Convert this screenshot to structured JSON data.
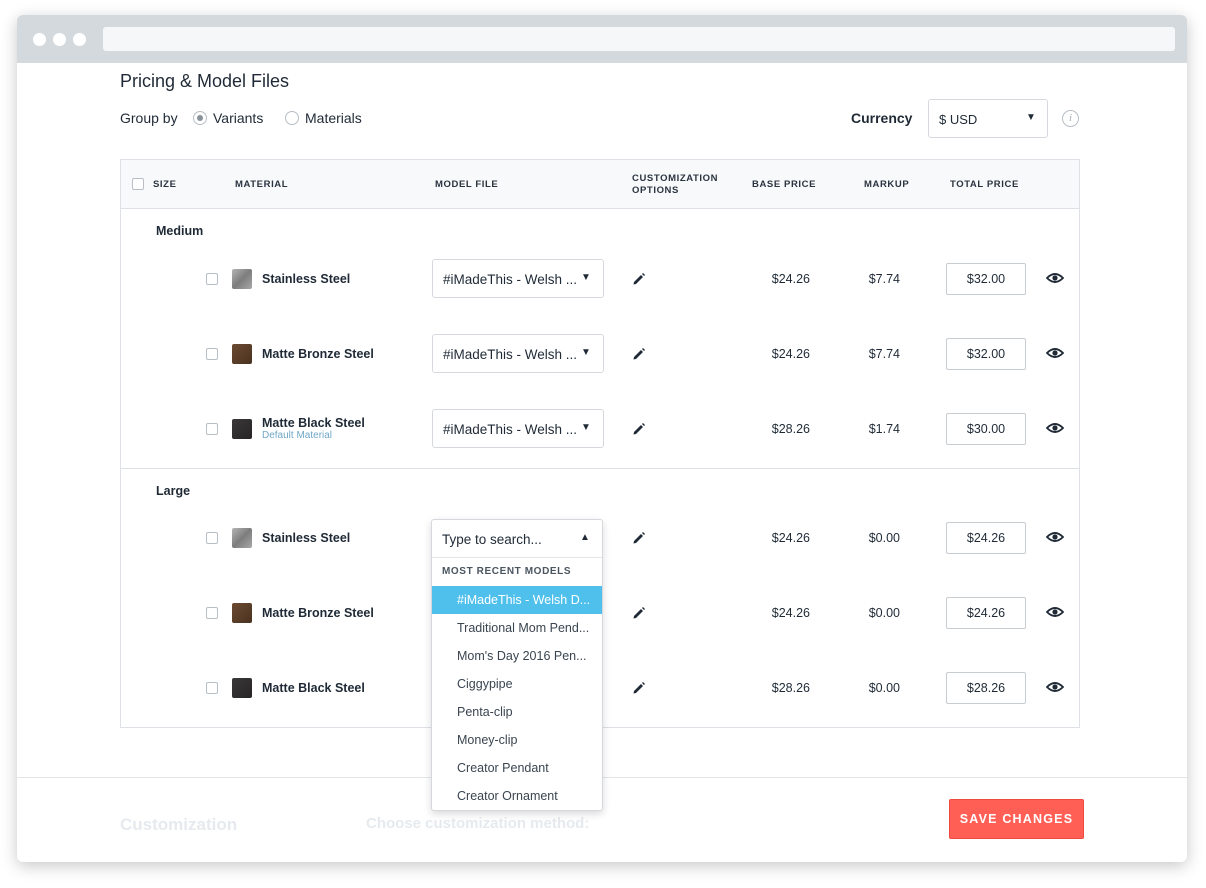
{
  "header": {
    "title": "Pricing & Model Files",
    "group_by_label": "Group by",
    "group_by_options": [
      "Variants",
      "Materials"
    ],
    "group_by_selected": "Variants",
    "currency_label": "Currency",
    "currency_value": "$ USD"
  },
  "table": {
    "columns": {
      "size": "SIZE",
      "material": "MATERIAL",
      "model_file": "MODEL FILE",
      "customization_1": "CUSTOMIZATION",
      "customization_2": "OPTIONS",
      "base_price": "BASE PRICE",
      "markup": "MARKUP",
      "total_price": "TOTAL PRICE"
    },
    "groups": [
      {
        "label": "Medium",
        "rows": [
          {
            "material": "Stainless Steel",
            "sub": "",
            "model": "#iMadeThis - Welsh ...",
            "base": "$24.26",
            "markup": "$7.74",
            "total": "$32.00"
          },
          {
            "material": "Matte Bronze Steel",
            "sub": "",
            "model": "#iMadeThis - Welsh ...",
            "base": "$24.26",
            "markup": "$7.74",
            "total": "$32.00"
          },
          {
            "material": "Matte Black Steel",
            "sub": "Default Material",
            "model": "#iMadeThis - Welsh ...",
            "base": "$28.26",
            "markup": "$1.74",
            "total": "$30.00"
          }
        ]
      },
      {
        "label": "Large",
        "rows": [
          {
            "material": "Stainless Steel",
            "sub": "",
            "model": "Type to search...",
            "base": "$24.26",
            "markup": "$0.00",
            "total": "$24.26"
          },
          {
            "material": "Matte Bronze Steel",
            "sub": "",
            "model": "",
            "base": "$24.26",
            "markup": "$0.00",
            "total": "$24.26"
          },
          {
            "material": "Matte Black Steel",
            "sub": "",
            "model": "",
            "base": "$28.26",
            "markup": "$0.00",
            "total": "$28.26"
          }
        ]
      }
    ]
  },
  "dropdown": {
    "search_placeholder": "Type to search...",
    "header": "MOST RECENT MODELS",
    "items": [
      "#iMadeThis - Welsh D...",
      "Traditional Mom Pend...",
      "Mom's Day 2016 Pen...",
      "Ciggypipe",
      "Penta-clip",
      "Money-clip",
      "Creator Pendant",
      "Creator Ornament"
    ],
    "active_index": 0
  },
  "footer": {
    "section_label": "Customization",
    "method_label": "Choose customization method:",
    "save_label": "SAVE CHANGES"
  },
  "colors": {
    "accent_blue": "#4fc0ec",
    "save_button": "#ff5f55",
    "sub_label": "#6fa7c7",
    "swatch_stainless": "#8c8c8c",
    "swatch_bronze": "#5a3d26",
    "swatch_black": "#2d2b2c"
  },
  "icons": {
    "edit": "pencil-icon",
    "visibility": "eye-icon",
    "info": "info-icon",
    "select_caret": "triangle-down",
    "dropdown_caret": "triangle-up"
  }
}
